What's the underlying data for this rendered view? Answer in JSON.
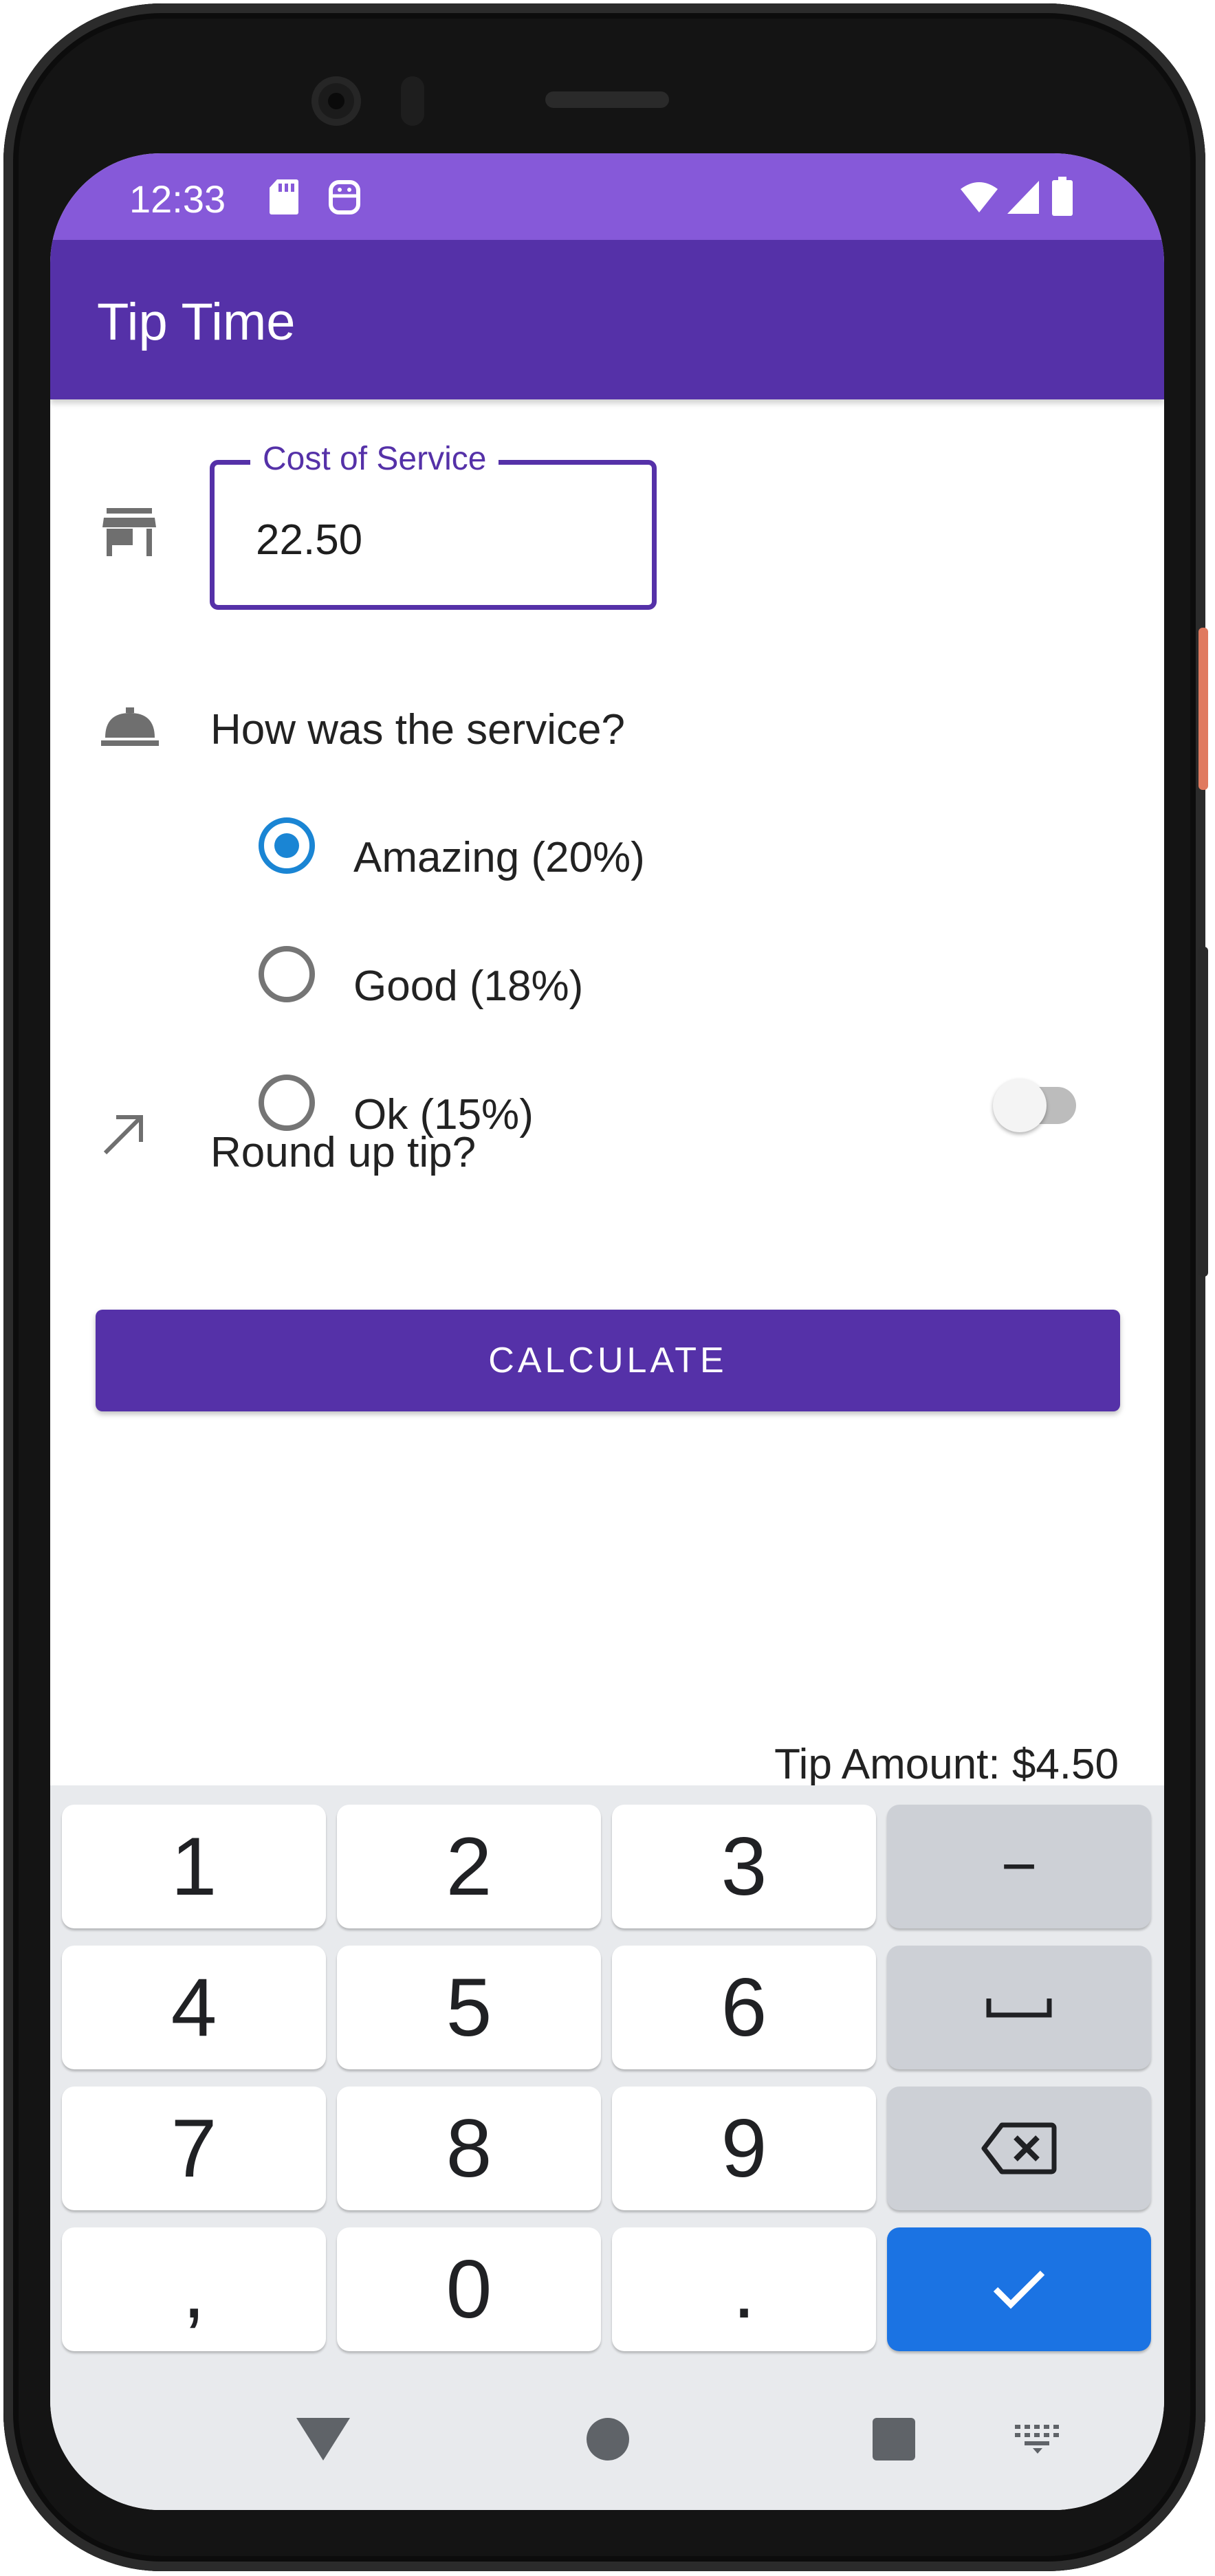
{
  "status_bar": {
    "time": "12:33",
    "left_icons": [
      "sd-card-icon",
      "robot-icon"
    ],
    "right_icons": [
      "wifi-icon",
      "cell-signal-icon",
      "battery-icon"
    ]
  },
  "app_bar": {
    "title": "Tip Time"
  },
  "cost_field": {
    "label": "Cost of Service",
    "value": "22.50",
    "icon": "storefront-icon"
  },
  "service": {
    "question": "How was the service?",
    "icon": "room-service-bell-icon",
    "options": [
      {
        "label": "Amazing (20%)",
        "selected": true
      },
      {
        "label": "Good (18%)",
        "selected": false
      },
      {
        "label": "Ok (15%)",
        "selected": false
      }
    ]
  },
  "round_up": {
    "label": "Round up tip?",
    "enabled": false,
    "icon": "trending-up-arrow-icon"
  },
  "calculate_button": {
    "label": "CALCULATE"
  },
  "result": {
    "tip_amount": "Tip Amount: $4.50"
  },
  "keyboard": {
    "keys": [
      [
        "1",
        "2",
        "3",
        "−"
      ],
      [
        "4",
        "5",
        "6",
        "space"
      ],
      [
        "7",
        "8",
        "9",
        "backspace"
      ],
      [
        ",",
        "0",
        ".",
        "done"
      ]
    ]
  },
  "colors": {
    "status_bar": "#8659d9",
    "app_bar": "#5531a8",
    "radio_selected": "#1a85d4",
    "done_key": "#1b73e3"
  },
  "nav_bar": {
    "icons": [
      "back-icon",
      "home-icon",
      "recents-icon",
      "keyboard-switch-icon"
    ]
  }
}
